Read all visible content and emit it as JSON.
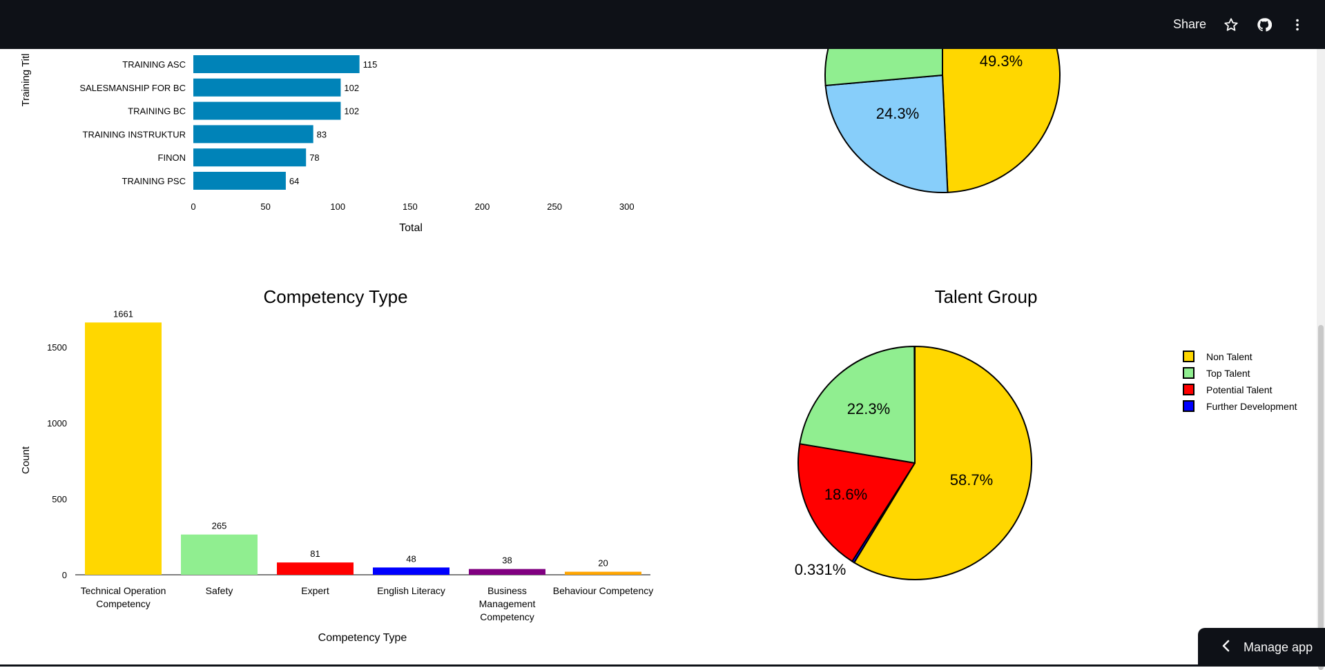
{
  "header": {
    "share_label": "Share",
    "icons": [
      "star-icon",
      "github-icon",
      "more-vertical-icon"
    ]
  },
  "manage_app_label": "Manage app",
  "charts": {
    "training": {
      "ylabel": "Training Titl",
      "xlabel": "Total",
      "bar_color": "#0083b8"
    },
    "top_pie": {
      "labels": [
        "49.3%",
        "24.3%"
      ]
    },
    "competency": {
      "title": "Competency Type",
      "xlabel": "Competency Type",
      "ylabel": "Count"
    },
    "talent": {
      "title": "Talent Group",
      "labels": [
        "58.7%",
        "18.6%",
        "22.3%",
        "0.331%"
      ]
    }
  },
  "chart_data": [
    {
      "type": "bar",
      "orientation": "horizontal",
      "categories": [
        "TRAINING ASC",
        "SALESMANSHIP FOR BC",
        "TRAINING BC",
        "TRAINING INSTRUKTUR",
        "FINON",
        "TRAINING  PSC"
      ],
      "values": [
        115,
        102,
        102,
        83,
        78,
        64
      ],
      "xlabel": "Total",
      "ylabel": "Training Titl",
      "xticks": [
        0,
        50,
        100,
        150,
        200,
        250,
        300
      ],
      "xlim": [
        0,
        310
      ]
    },
    {
      "type": "pie",
      "visible_slices": [
        {
          "label": "49.3%",
          "value": 49.3,
          "color": "#ffd700"
        },
        {
          "label": "24.3%",
          "value": 24.3,
          "color": "#87cefa"
        },
        {
          "label": "",
          "value": 26.4,
          "color": "#90ee90"
        }
      ]
    },
    {
      "type": "bar",
      "title": "Competency Type",
      "categories": [
        "Technical Operation Competency",
        "Safety",
        "Expert",
        "English Literacy",
        "Business Management Competency",
        "Behaviour Competency"
      ],
      "values": [
        1661,
        265,
        81,
        48,
        38,
        20
      ],
      "colors": [
        "#ffd700",
        "#90ee90",
        "#ff0000",
        "#0000ff",
        "#800080",
        "#ffa500"
      ],
      "xlabel": "Competency Type",
      "ylabel": "Count",
      "yticks": [
        0,
        500,
        1000,
        1500
      ],
      "ylim": [
        0,
        1750
      ]
    },
    {
      "type": "pie",
      "title": "Talent Group",
      "slices": [
        {
          "name": "Non Talent",
          "value": 58.7,
          "label": "58.7%",
          "color": "#ffd700"
        },
        {
          "name": "Further Development",
          "value": 0.331,
          "label": "0.331%",
          "color": "#0000ff"
        },
        {
          "name": "Potential Talent",
          "value": 18.6,
          "label": "18.6%",
          "color": "#ff0000"
        },
        {
          "name": "Top Talent",
          "value": 22.3,
          "label": "22.3%",
          "color": "#90ee90"
        }
      ],
      "legend": [
        "Non Talent",
        "Top Talent",
        "Potential Talent",
        "Further Development"
      ],
      "legend_position": "right"
    }
  ]
}
